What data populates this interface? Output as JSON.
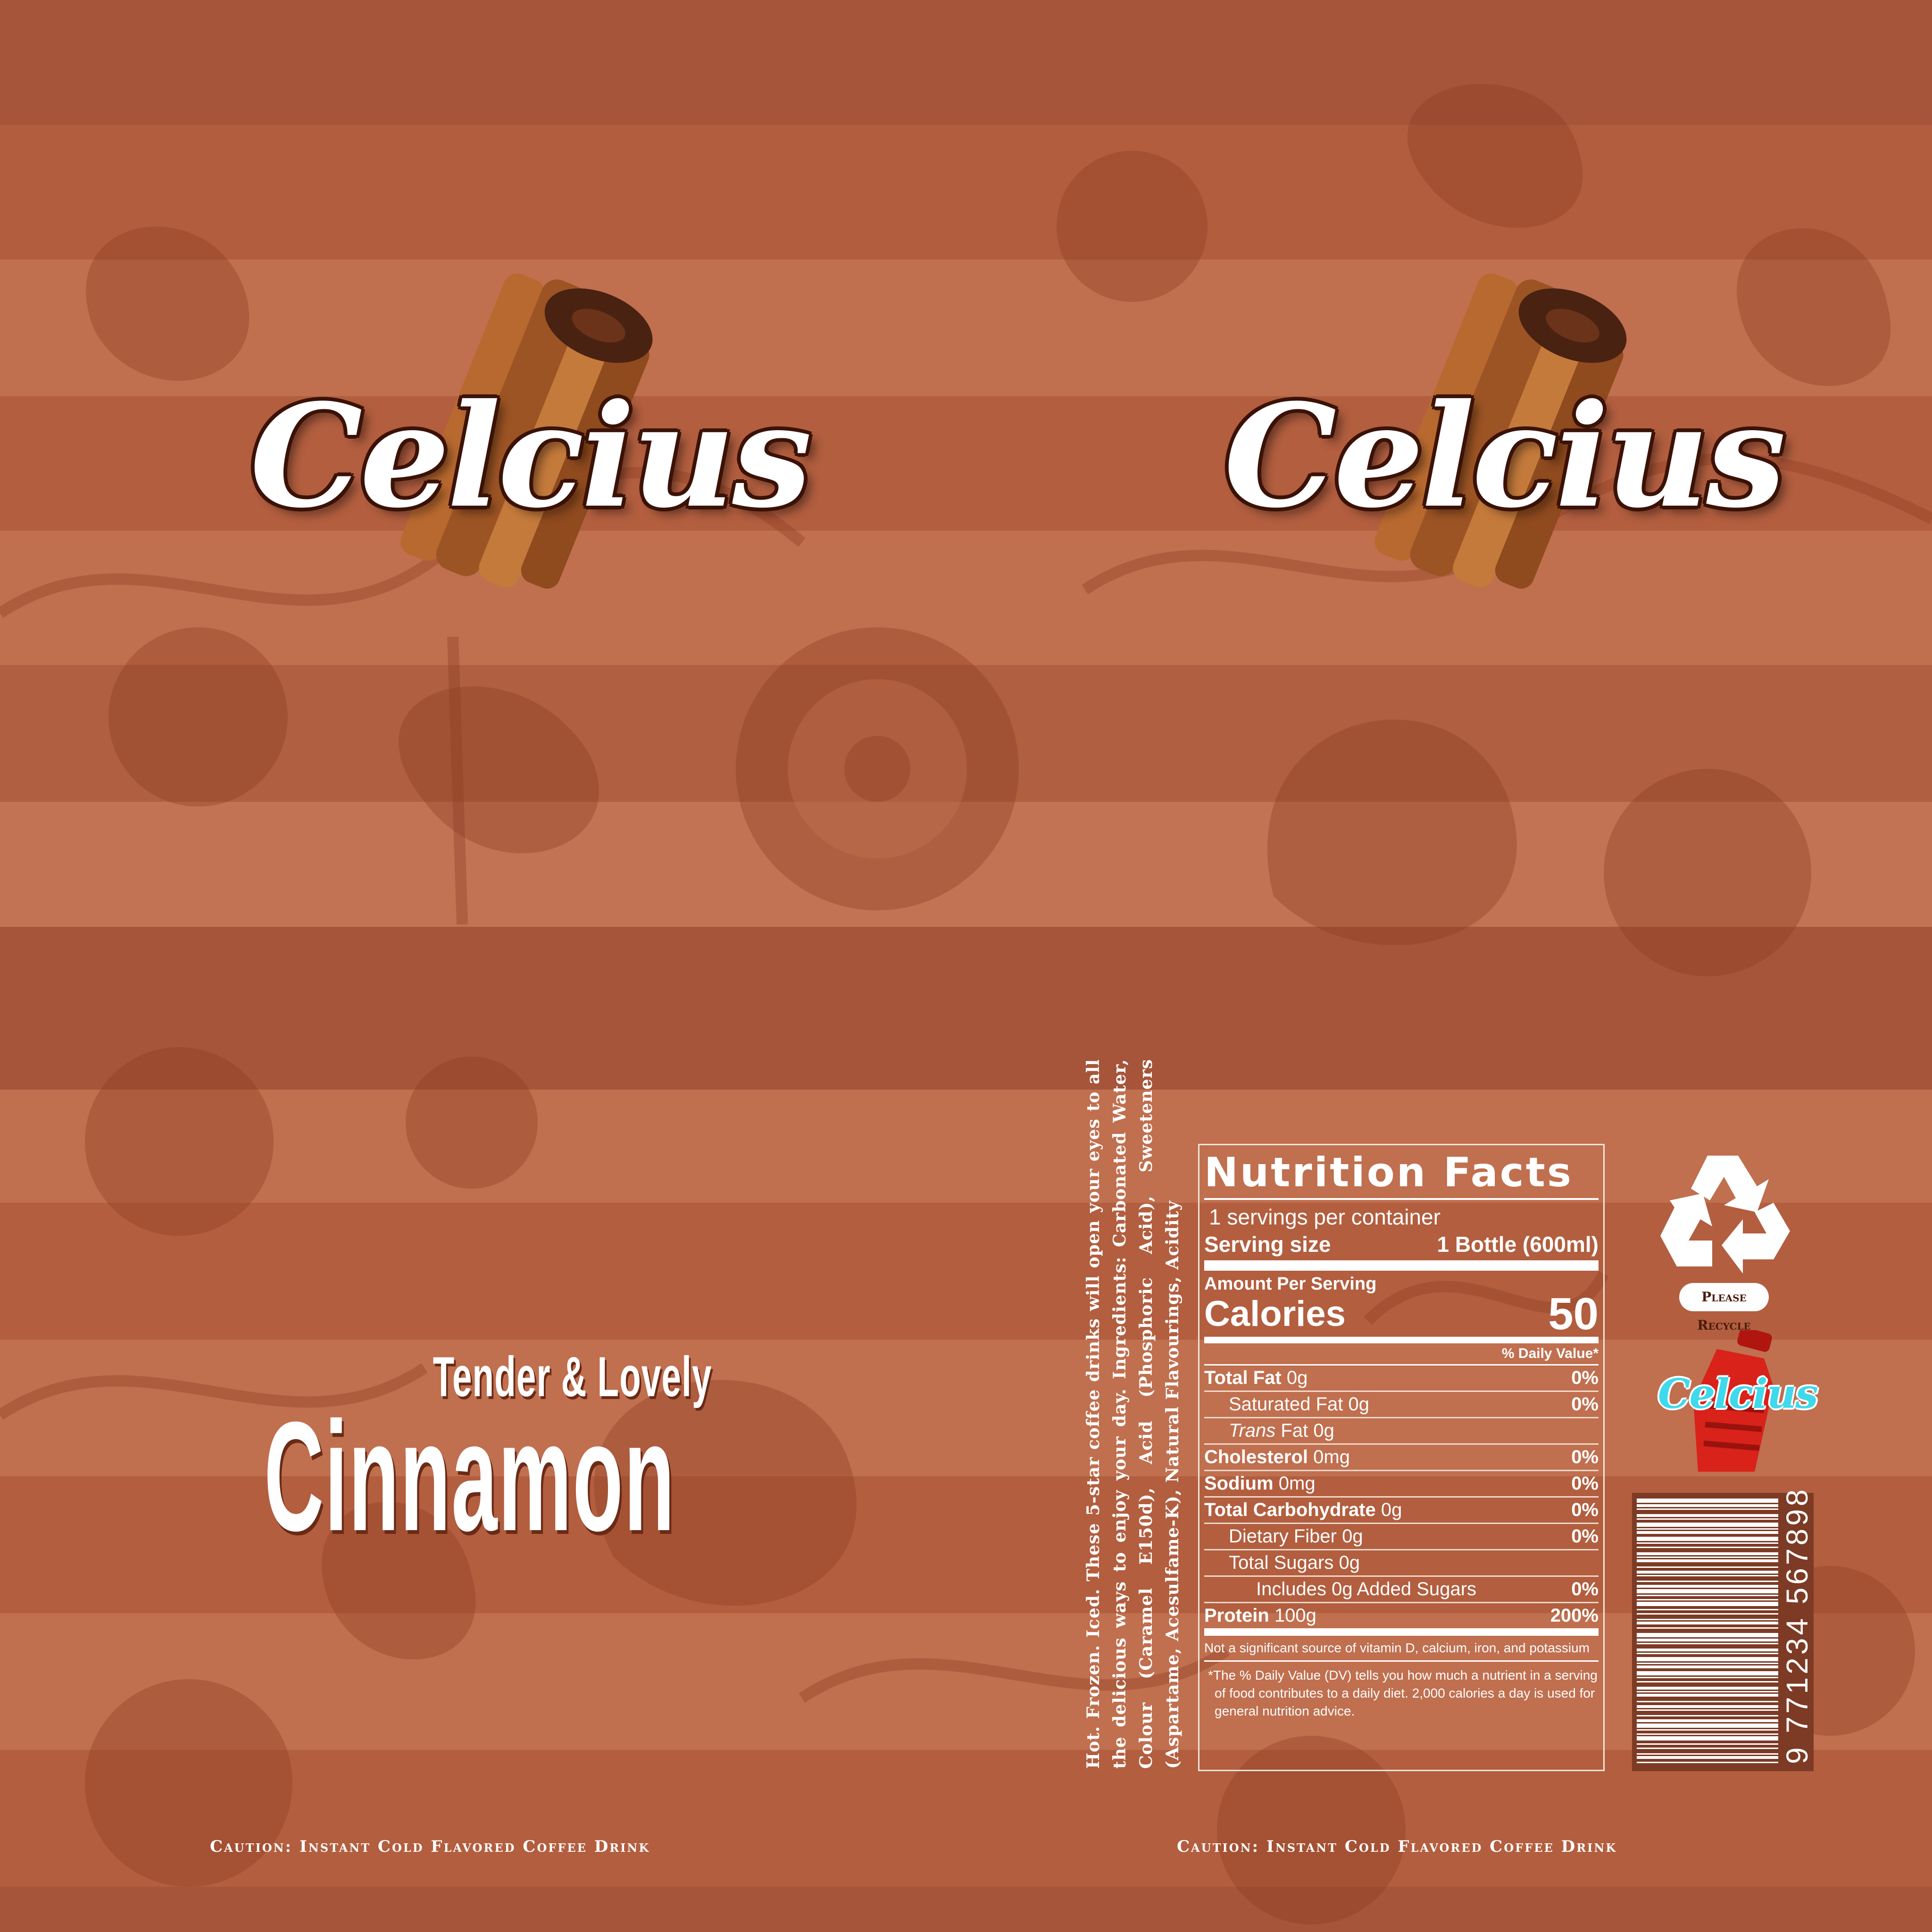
{
  "brand": {
    "name": "Celcius"
  },
  "product": {
    "tagline": "Tender & Lovely",
    "name": "Cinnamon"
  },
  "caution": "Caution: Instant Cold Flavored Coffee Drink",
  "ingredients_text": "Hot. Frozen. Iced. These 5-star coffee drinks will open your eyes to all the delicious ways to enjoy your day. Ingredients: Carbonated Water, Colour (Caramel E150d), Acid (Phosphoric Acid), Sweeteners (Aspartame, Acesulfame-K), Natural Flavourings, Acidity",
  "nutrition": {
    "title": "Nutrition Facts",
    "servings": "1 servings per container",
    "serving_size_label": "Serving size",
    "serving_size_value": "1 Bottle (600ml)",
    "amount_per_serving": "Amount Per Serving",
    "calories_label": "Calories",
    "calories_value": "50",
    "dv_header": "% Daily Value*",
    "rows": [
      {
        "label": "Total Fat",
        "amount": "0g",
        "pct": "0%"
      },
      {
        "label": "Saturated Fat",
        "amount": "0g",
        "pct": "0%"
      },
      {
        "label": "Trans",
        "label2": "Fat",
        "amount": "0g",
        "pct": ""
      },
      {
        "label": "Cholesterol",
        "amount": "0mg",
        "pct": "0%"
      },
      {
        "label": "Sodium",
        "amount": "0mg",
        "pct": "0%"
      },
      {
        "label": "Total Carbohydrate",
        "amount": "0g",
        "pct": "0%"
      },
      {
        "label": "Dietary Fiber",
        "amount": "0g",
        "pct": "0%"
      },
      {
        "label": "Total Sugars",
        "amount": "0g",
        "pct": ""
      },
      {
        "label": "Includes 0g Added Sugars",
        "amount": "",
        "pct": "0%"
      },
      {
        "label": "Protein",
        "amount": "100g",
        "pct": "200%"
      }
    ],
    "note": "Not a significant source of vitamin D, calcium, iron, and potassium",
    "footnote": "*The % Daily Value (DV) tells you how much a nutrient in a serving of food contributes to a daily diet. 2,000 calories a day is used for general nutrition advice."
  },
  "recycle_label": "Please Recycle",
  "barcode_number": "9 771234 567898",
  "colors": {
    "background": "#a9573a",
    "stripe_dark": "#8f3f25",
    "stripe_light": "#c0704f",
    "text": "#ffffff",
    "bottle": "#d8221a",
    "bottle_logo": "#3fd9ec"
  },
  "icons": [
    "cinnamon-sticks-icon",
    "recycle-icon",
    "bottle-icon",
    "barcode-icon"
  ]
}
